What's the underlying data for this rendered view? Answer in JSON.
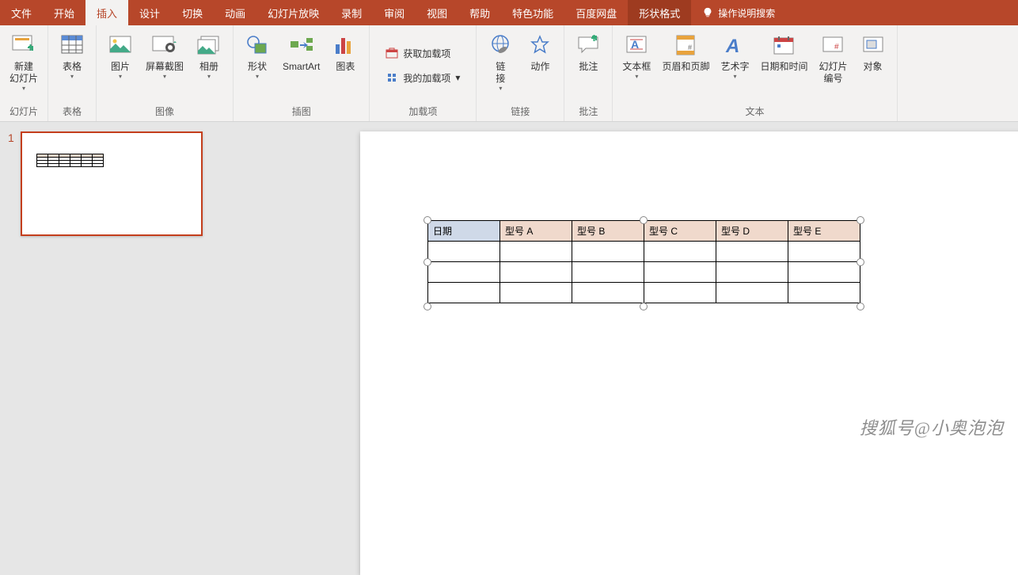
{
  "tabs": {
    "file": "文件",
    "home": "开始",
    "insert": "插入",
    "design": "设计",
    "transitions": "切换",
    "animations": "动画",
    "slideshow": "幻灯片放映",
    "record": "录制",
    "review": "审阅",
    "view": "视图",
    "help": "帮助",
    "special": "特色功能",
    "baidu": "百度网盘",
    "shapeformat": "形状格式",
    "search": "操作说明搜索"
  },
  "ribbon": {
    "slides": {
      "label": "幻灯片",
      "newslide": "新建\n幻灯片"
    },
    "tables": {
      "label": "表格",
      "table": "表格"
    },
    "images": {
      "label": "图像",
      "pictures": "图片",
      "screenshot": "屏幕截图",
      "album": "相册"
    },
    "illustrations": {
      "label": "插图",
      "shapes": "形状",
      "smartart": "SmartArt",
      "chart": "图表"
    },
    "addins": {
      "label": "加载项",
      "get": "获取加载项",
      "my": "我的加载项"
    },
    "links": {
      "label": "链接",
      "link": "链\n接",
      "action": "动作"
    },
    "comments": {
      "label": "批注",
      "comment": "批注"
    },
    "text": {
      "label": "文本",
      "textbox": "文本框",
      "headerfooter": "页眉和页脚",
      "wordart": "艺术字",
      "datetime": "日期和时间",
      "slidenum": "幻灯片\n编号",
      "object": "对象"
    }
  },
  "slide_panel": {
    "num1": "1"
  },
  "chart_data": {
    "type": "table",
    "headers": [
      "日期",
      "型号 A",
      "型号 B",
      "型号 C",
      "型号 D",
      "型号 E"
    ],
    "rows": [
      [
        "",
        "",
        "",
        "",
        "",
        ""
      ],
      [
        "",
        "",
        "",
        "",
        "",
        ""
      ],
      [
        "",
        "",
        "",
        "",
        "",
        ""
      ]
    ]
  },
  "watermark": "搜狐号@小奥泡泡"
}
